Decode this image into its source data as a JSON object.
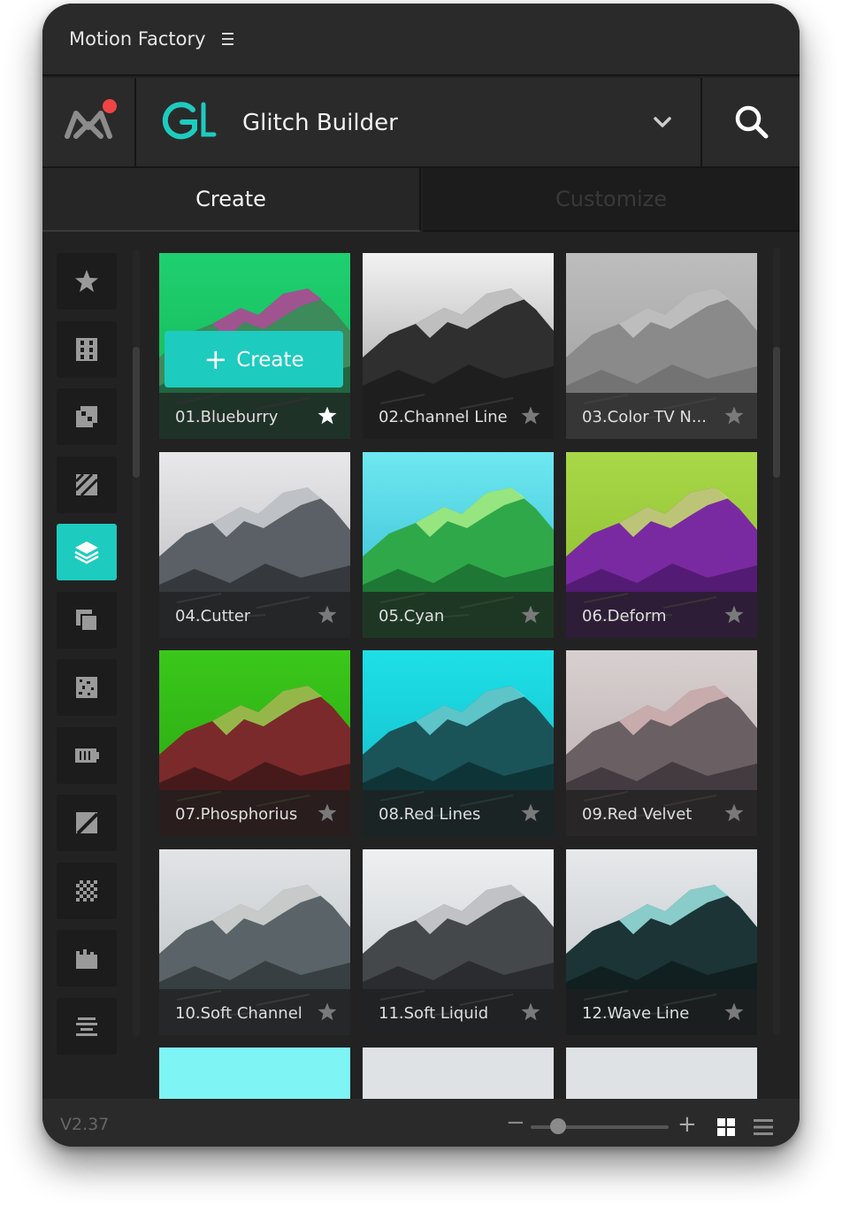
{
  "window": {
    "title": "Motion Factory"
  },
  "header": {
    "plugin_name": "Glitch Builder",
    "brand_color": "#1ecbbf",
    "notification_color": "#ee4444"
  },
  "tabs": [
    {
      "label": "Create",
      "active": true
    },
    {
      "label": "Customize",
      "active": false
    }
  ],
  "sidebar": {
    "items": [
      {
        "icon": "star-icon",
        "active": false
      },
      {
        "icon": "film-strip-icon",
        "active": false
      },
      {
        "icon": "pixel-block-icon",
        "active": false
      },
      {
        "icon": "diagonal-stripes-icon",
        "active": false
      },
      {
        "icon": "layers-icon",
        "active": true
      },
      {
        "icon": "copy-icon",
        "active": false
      },
      {
        "icon": "noise-icon",
        "active": false
      },
      {
        "icon": "battery-icon",
        "active": false
      },
      {
        "icon": "slash-square-icon",
        "active": false
      },
      {
        "icon": "checkerboard-icon",
        "active": false
      },
      {
        "icon": "bars-chart-icon",
        "active": false
      },
      {
        "icon": "align-lines-icon",
        "active": false
      }
    ]
  },
  "grid": {
    "create_label": "Create",
    "items": [
      {
        "label": "01.Blueburry",
        "favorite": true,
        "sky": "#1fd070",
        "sky2": "#13b455",
        "mountain": "#3d8a5a",
        "snow": "#b04a9a",
        "ground": "#1d5a3a"
      },
      {
        "label": "02.Channel Line",
        "favorite": false,
        "sky": "#f2f2f2",
        "sky2": "#9a9a9a",
        "mountain": "#2f2f2f",
        "snow": "#d8d8d8",
        "ground": "#1a1a1a"
      },
      {
        "label": "03.Color TV N...",
        "favorite": false,
        "sky": "#bdbdbd",
        "sky2": "#9c9c9c",
        "mountain": "#8a8a8a",
        "snow": "#c6c6c6",
        "ground": "#6d6d6d"
      },
      {
        "label": "04.Cutter",
        "favorite": false,
        "sky": "#e8e8ea",
        "sky2": "#b8b8bc",
        "mountain": "#5a6066",
        "snow": "#d0d4d8",
        "ground": "#2c3034"
      },
      {
        "label": "05.Cyan",
        "favorite": false,
        "sky": "#6ee8f0",
        "sky2": "#2fb8d0",
        "mountain": "#2fa84a",
        "snow": "#a8f08a",
        "ground": "#1a6a2e"
      },
      {
        "label": "06.Deform",
        "favorite": false,
        "sky": "#a8d848",
        "sky2": "#8ab82c",
        "mountain": "#7a2aa0",
        "snow": "#c8e070",
        "ground": "#4a1868"
      },
      {
        "label": "07.Phosphorius",
        "favorite": false,
        "sky": "#3ac81a",
        "sky2": "#2aa012",
        "mountain": "#7a2a2a",
        "snow": "#9ad050",
        "ground": "#3a1616"
      },
      {
        "label": "08.Red Lines",
        "favorite": false,
        "sky": "#1ee0e6",
        "sky2": "#12b8c8",
        "mountain": "#1a5458",
        "snow": "#6ad8dc",
        "ground": "#0c2c30"
      },
      {
        "label": "09.Red Velvet",
        "favorite": false,
        "sky": "#d8d0d0",
        "sky2": "#b8a8aa",
        "mountain": "#6a6064",
        "snow": "#d8b8b8",
        "ground": "#3a3236"
      },
      {
        "label": "10.Soft Channel",
        "favorite": false,
        "sky": "#e2e4e6",
        "sky2": "#b6bcc0",
        "mountain": "#5a6468",
        "snow": "#dcdcdc",
        "ground": "#303638"
      },
      {
        "label": "11.Soft Liquid",
        "favorite": false,
        "sky": "#eef0f2",
        "sky2": "#c2c6c8",
        "mountain": "#44484a",
        "snow": "#d6d8da",
        "ground": "#242628"
      },
      {
        "label": "12.Wave Line",
        "favorite": false,
        "sky": "#e6e8ea",
        "sky2": "#bcc2c6",
        "mountain": "#1c3436",
        "snow": "#9ee8e4",
        "ground": "#0e1a1a"
      },
      {
        "label": "",
        "favorite": false,
        "sky": "#7ef4f4",
        "sky2": "#7ef4f4",
        "mountain": "#7ef4f4",
        "snow": "#7ef4f4",
        "ground": "#7ef4f4"
      },
      {
        "label": "",
        "favorite": false,
        "sky": "#dfe2e4",
        "sky2": "#dfe2e4",
        "mountain": "#dfe2e4",
        "snow": "#dfe2e4",
        "ground": "#dfe2e4"
      },
      {
        "label": "",
        "favorite": false,
        "sky": "#dfe2e4",
        "sky2": "#dfe2e4",
        "mountain": "#dfe2e4",
        "snow": "#dfe2e4",
        "ground": "#dfe2e4"
      }
    ]
  },
  "footer": {
    "version": "V2.37",
    "zoom_out_label": "−",
    "zoom_in_label": "+",
    "zoom_level": 0.2
  }
}
